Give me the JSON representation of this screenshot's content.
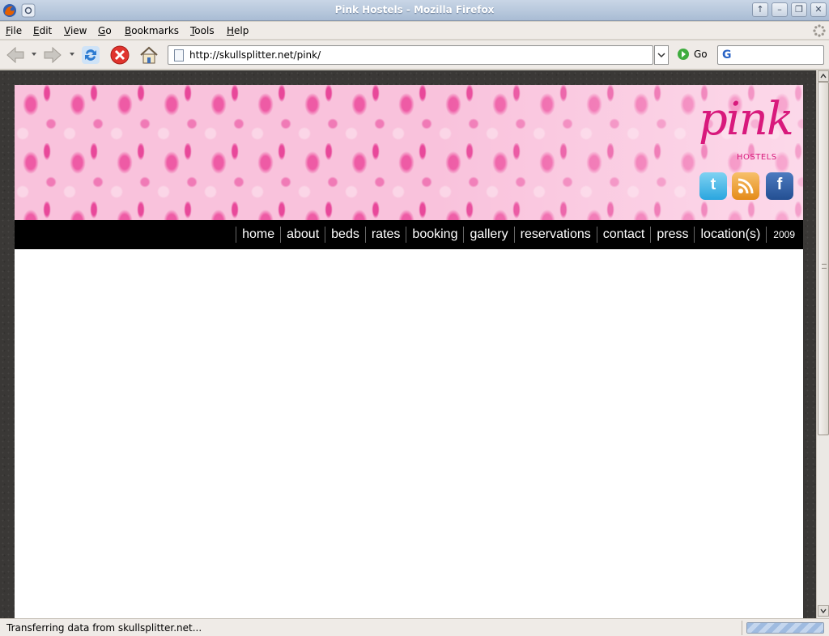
{
  "window": {
    "title": "Pink Hostels - Mozilla Firefox"
  },
  "menubar": {
    "items": [
      "File",
      "Edit",
      "View",
      "Go",
      "Bookmarks",
      "Tools",
      "Help"
    ],
    "underlined": [
      "F",
      "E",
      "V",
      "G",
      "B",
      "T",
      "H"
    ]
  },
  "toolbar": {
    "url": "http://skullsplitter.net/pink/",
    "go_label": "Go"
  },
  "site": {
    "logo_word": "pink",
    "logo_sub": "HOSTELS",
    "social": [
      "twitter-icon",
      "rss-icon",
      "facebook-icon"
    ],
    "nav": [
      "home",
      "about",
      "beds",
      "rates",
      "booking",
      "gallery",
      "reservations",
      "contact",
      "press",
      "location(s)"
    ],
    "nav_year": "2009",
    "colors": {
      "brand_pink": "#d8197c",
      "nav_bg": "#000000"
    }
  },
  "status": {
    "text": "Transferring data from skullsplitter.net...",
    "progress": "indeterminate"
  }
}
